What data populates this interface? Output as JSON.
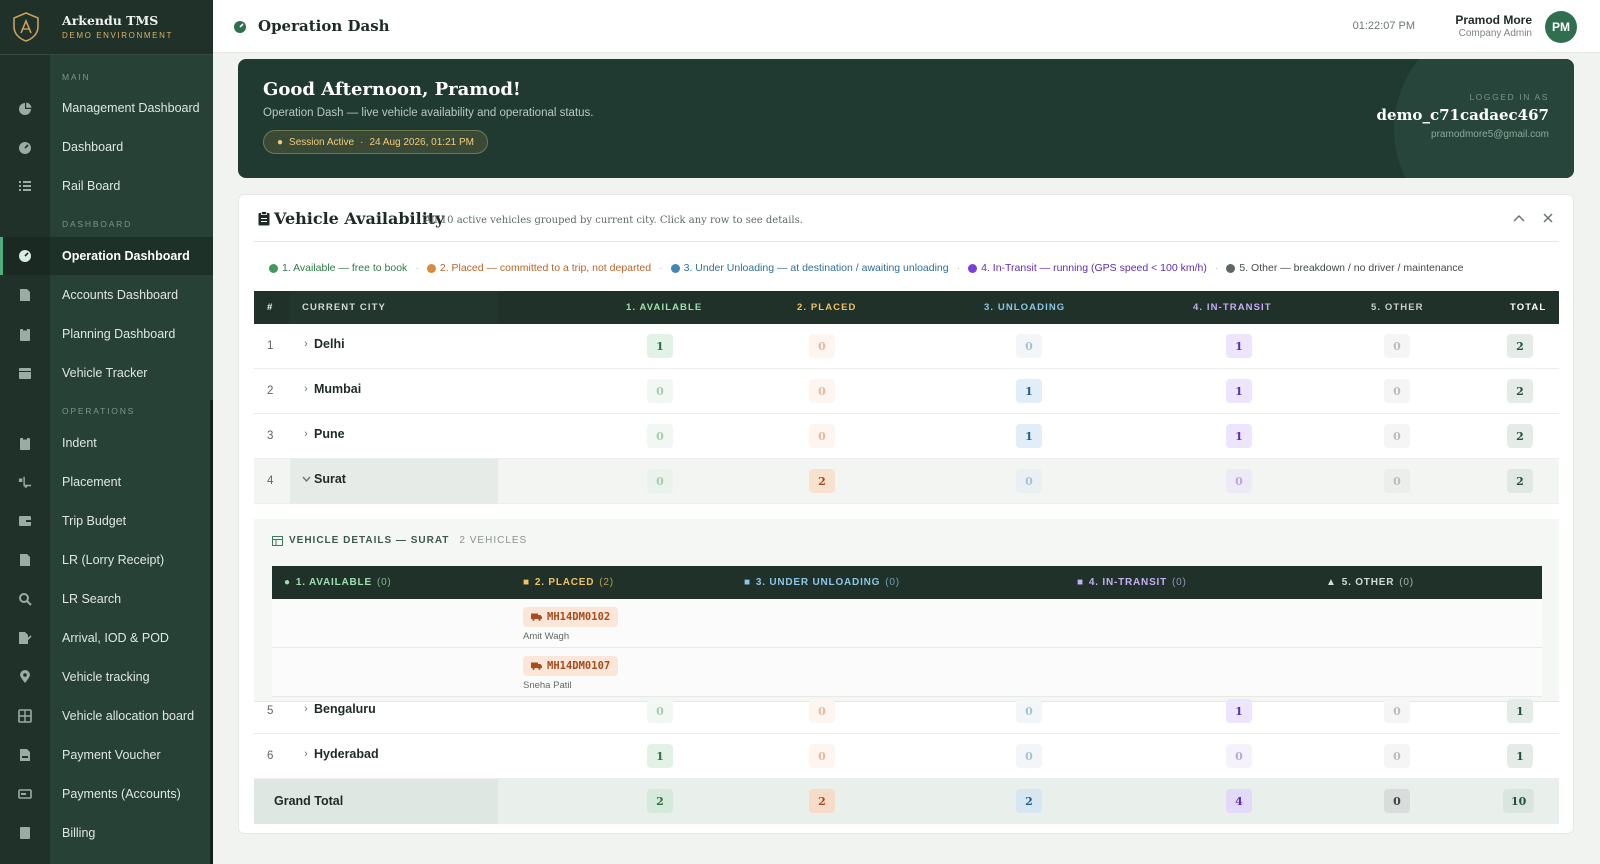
{
  "brand": {
    "title": "Arkendu TMS",
    "subtitle": "DEMO ENVIRONMENT"
  },
  "sidebar": {
    "sections": [
      {
        "label": "MAIN",
        "items": [
          {
            "label": "Management Dashboard",
            "icon": "pie-chart-icon"
          },
          {
            "label": "Dashboard",
            "icon": "gauge-icon"
          },
          {
            "label": "Rail Board",
            "icon": "list-icon"
          }
        ]
      },
      {
        "label": "DASHBOARD",
        "items": [
          {
            "label": "Operation Dashboard",
            "icon": "gauge-icon",
            "active": true
          },
          {
            "label": "Accounts Dashboard",
            "icon": "file-icon"
          },
          {
            "label": "Planning Dashboard",
            "icon": "clipboard-icon"
          },
          {
            "label": "Vehicle Tracker",
            "icon": "calendar-icon"
          }
        ]
      },
      {
        "label": "OPERATIONS",
        "items": [
          {
            "label": "Indent",
            "icon": "clipboard-icon"
          },
          {
            "label": "Placement",
            "icon": "truck-loading-icon"
          },
          {
            "label": "Trip Budget",
            "icon": "wallet-icon"
          },
          {
            "label": "LR (Lorry Receipt)",
            "icon": "file-icon"
          },
          {
            "label": "LR Search",
            "icon": "search-icon"
          },
          {
            "label": "Arrival, IOD & POD",
            "icon": "file-signature-icon"
          },
          {
            "label": "Vehicle tracking",
            "icon": "location-pin-icon"
          },
          {
            "label": "Vehicle allocation board",
            "icon": "grid-icon"
          },
          {
            "label": "Payment Voucher",
            "icon": "file-invoice-icon"
          },
          {
            "label": "Payments (Accounts)",
            "icon": "money-icon"
          },
          {
            "label": "Billing",
            "icon": "receipt-icon"
          }
        ]
      }
    ]
  },
  "topbar": {
    "title": "Operation Dash",
    "clock": "01:22:07 PM",
    "user_name": "Pramod More",
    "user_role": "Company Admin",
    "avatar": "PM"
  },
  "hero": {
    "greeting": "Good Afternoon, Pramod!",
    "subtitle": "Operation Dash — live vehicle availability and operational status.",
    "session_status": "Session Active",
    "session_time": "24 Aug 2026, 01:21 PM",
    "logged_label": "LOGGED IN AS",
    "username": "demo_c71cadaec467",
    "email": "pramodmore5@gmail.com"
  },
  "card": {
    "title": "Vehicle Availability",
    "subtitle": "All 10 active vehicles grouped by current city. Click any row to see details.",
    "legend": [
      {
        "label": "1. Available — free to book",
        "color": "#3f9a5c"
      },
      {
        "label": "2. Placed — committed to a trip, not departed",
        "color": "#d98a3c"
      },
      {
        "label": "3. Under Unloading — at destination / awaiting unloading",
        "color": "#3f86b2"
      },
      {
        "label": "4. In-Transit — running (GPS speed < 100 km/h)",
        "color": "#7b3fe0"
      },
      {
        "label": "5. Other — breakdown / no driver / maintenance",
        "color": "#5f6763"
      }
    ]
  },
  "table": {
    "headers": {
      "idx": "#",
      "city": "CURRENT CITY",
      "available": "1. AVAILABLE",
      "placed": "2. PLACED",
      "unloading": "3. UNLOADING",
      "transit": "4. IN-TRANSIT",
      "other": "5. OTHER",
      "total": "TOTAL"
    },
    "rows": [
      {
        "idx": "1",
        "city": "Delhi",
        "available": "1",
        "placed": "0",
        "unloading": "0",
        "transit": "1",
        "other": "0",
        "total": "2"
      },
      {
        "idx": "2",
        "city": "Mumbai",
        "available": "0",
        "placed": "0",
        "unloading": "1",
        "transit": "1",
        "other": "0",
        "total": "2"
      },
      {
        "idx": "3",
        "city": "Pune",
        "available": "0",
        "placed": "0",
        "unloading": "1",
        "transit": "1",
        "other": "0",
        "total": "2"
      },
      {
        "idx": "4",
        "city": "Surat",
        "available": "0",
        "placed": "2",
        "unloading": "0",
        "transit": "0",
        "other": "0",
        "total": "2"
      },
      {
        "idx": "5",
        "city": "Bengaluru",
        "available": "0",
        "placed": "0",
        "unloading": "0",
        "transit": "1",
        "other": "0",
        "total": "1"
      },
      {
        "idx": "6",
        "city": "Hyderabad",
        "available": "1",
        "placed": "0",
        "unloading": "0",
        "transit": "0",
        "other": "0",
        "total": "1"
      }
    ],
    "grand_total": {
      "label": "Grand Total",
      "available": "2",
      "placed": "2",
      "unloading": "2",
      "transit": "4",
      "other": "0",
      "total": "10"
    }
  },
  "details": {
    "title": "VEHICLE DETAILS — SURAT",
    "count": "2 VEHICLES",
    "columns": [
      {
        "label": "1. AVAILABLE",
        "count": "(0)"
      },
      {
        "label": "2. PLACED",
        "count": "(2)"
      },
      {
        "label": "3. UNDER UNLOADING",
        "count": "(0)"
      },
      {
        "label": "4. IN-TRANSIT",
        "count": "(0)"
      },
      {
        "label": "5. OTHER",
        "count": "(0)"
      }
    ],
    "vehicles": [
      {
        "number": "MH14DM0102",
        "driver": "Amit Wagh"
      },
      {
        "number": "MH14DM0107",
        "driver": "Sneha Patil"
      }
    ]
  }
}
